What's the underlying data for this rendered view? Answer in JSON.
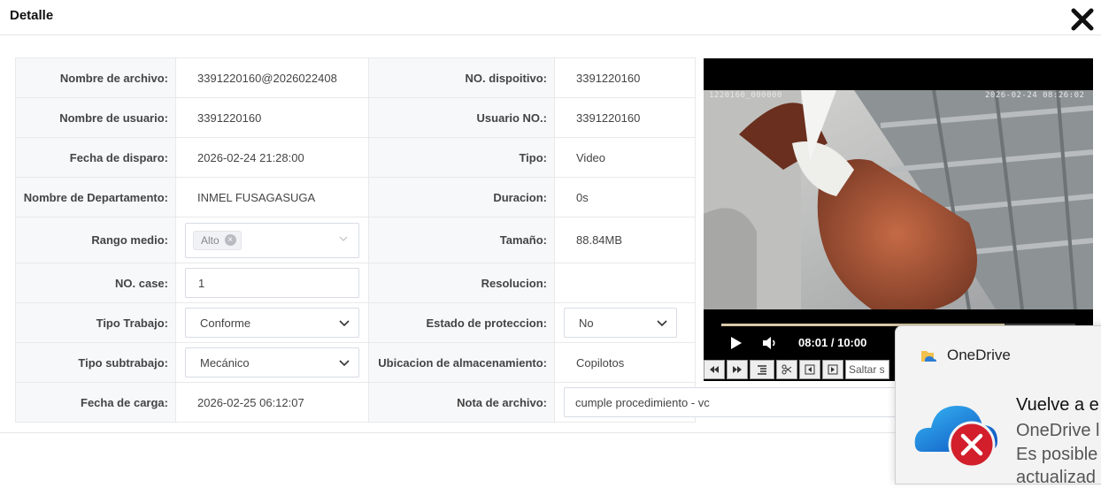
{
  "dialog": {
    "title": "Detalle"
  },
  "form": {
    "file_name_label": "Nombre de archivo:",
    "file_name": "3391220160@2026022408",
    "device_no_label": "NO. dispoitivo:",
    "device_no": "3391220160",
    "user_name_label": "Nombre de usuario:",
    "user_name": "3391220160",
    "user_no_label": "Usuario NO.:",
    "user_no": "3391220160",
    "trigger_date_label": "Fecha de disparo:",
    "trigger_date": "2026-02-24 21:28:00",
    "type_label": "Tipo:",
    "type": "Video",
    "department_label": "Nombre de Departamento:",
    "department": "INMEL FUSAGASUGA",
    "duration_label": "Duracion:",
    "duration": "0s",
    "range_label": "Rango medio:",
    "range_tag": "Alto",
    "size_label": "Tamaño:",
    "size": "88.84MB",
    "case_label": "NO. case:",
    "case_value": "1",
    "resolution_label": "Resolucion:",
    "resolution": "",
    "work_type_label": "Tipo Trabajo:",
    "work_type": "Conforme",
    "protection_label": "Estado de proteccion:",
    "protection": "No",
    "subwork_label": "Tipo subtrabajo:",
    "subwork": "Mecánico",
    "storage_label": "Ubicacion de almacenamiento:",
    "storage": "Copilotos",
    "upload_date_label": "Fecha de carga:",
    "upload_date": "2026-02-25 06:12:07",
    "note_label": "Nota de archivo:",
    "note": "cumple procedimiento - vc"
  },
  "video": {
    "osd_left": "1220160_000000",
    "osd_right": "2026-02-24 08:26:02",
    "time": "08:01 / 10:00",
    "progress": 0.8,
    "seek_placeholder": "Saltar s"
  },
  "toast": {
    "app": "OneDrive",
    "headline": "Vuelve a e",
    "line1": "OneDrive l",
    "line2": "Es posible",
    "line3": "actualizad"
  }
}
